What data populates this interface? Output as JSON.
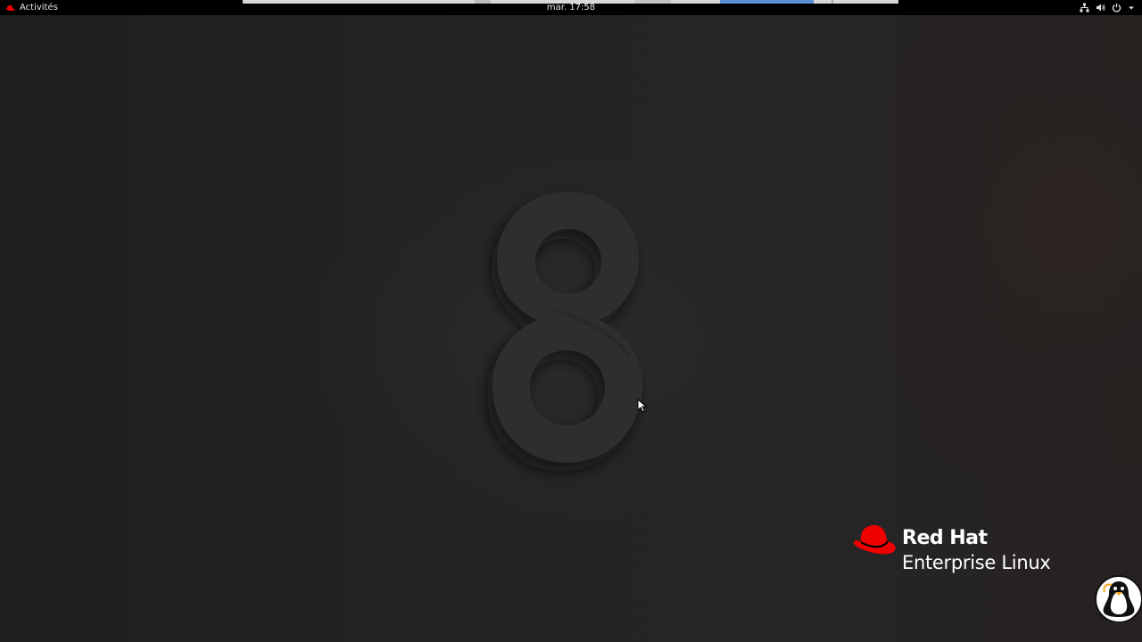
{
  "topbar": {
    "activities_label": "Activités",
    "clock_label": "mar. 17:58",
    "tray_icons": [
      "network-icon",
      "volume-icon",
      "power-icon",
      "chevron-down-icon"
    ]
  },
  "desktop": {
    "wallpaper_numeral": "8"
  },
  "branding": {
    "line1": "Red Hat",
    "line2": "Enterprise Linux",
    "hat_color": "#ee0000"
  },
  "colors": {
    "topbar_bg": "#000000",
    "wallpaper_bg": "#232223",
    "numeral_fill": "#2f2e2f"
  }
}
